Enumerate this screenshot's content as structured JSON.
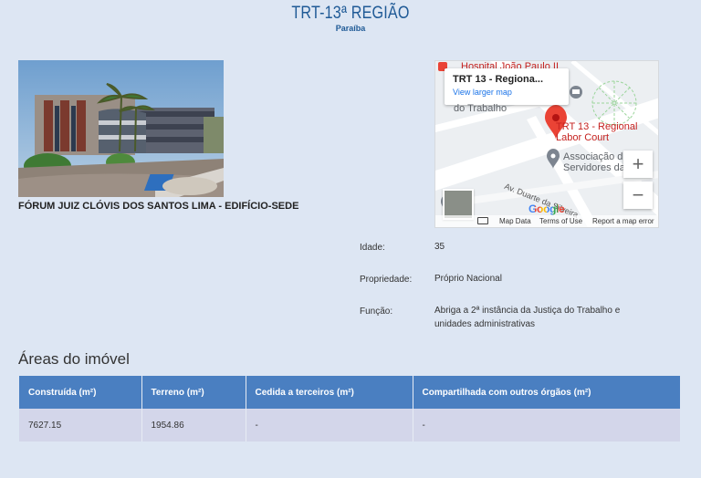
{
  "header": {
    "logo_title": "TRT-13ª REGIÃO",
    "logo_subtitle": "Paraíba"
  },
  "building": {
    "caption": "FÓRUM JUIZ CLÓVIS DOS SANTOS LIMA - EDIFÍCIO-SEDE"
  },
  "map": {
    "card_title": "TRT 13 - Regiona...",
    "card_link": "View larger map",
    "poi_hospital": "Hospital João Paulo II",
    "poi_place_1": "TRT 13 - Regional",
    "poi_place_2": "Labor Court",
    "poi_assoc_1": "Associação d",
    "poi_assoc_2": "Servidores da",
    "poi_partial": "do Trabalho",
    "street": "Av. Duarte da Silveira",
    "zoom_in": "+",
    "zoom_out": "−",
    "google": "Google",
    "map_data": "Map Data",
    "terms": "Terms of Use",
    "report": "Report a map error"
  },
  "info": {
    "idade_label": "Idade:",
    "idade_value": "35",
    "propriedade_label": "Propriedade:",
    "propriedade_value": "Próprio Nacional",
    "funcao_label": "Função:",
    "funcao_value": "Abriga a 2ª instância da Justiça do Trabalho e unidades administrativas"
  },
  "areas": {
    "title": "Áreas do imóvel",
    "headers": [
      "Construída (m²)",
      "Terreno (m²)",
      "Cedida a terceiros (m²)",
      "Compartilhada com outros órgãos (m²)"
    ],
    "row": [
      "7627.15",
      "1954.86",
      "-",
      "-"
    ]
  },
  "colors": {
    "header_blue": "#4a7fc1",
    "logo_blue": "#1f5a96",
    "row_bg": "#d3d6ea",
    "page_bg": "#dde6f3"
  }
}
